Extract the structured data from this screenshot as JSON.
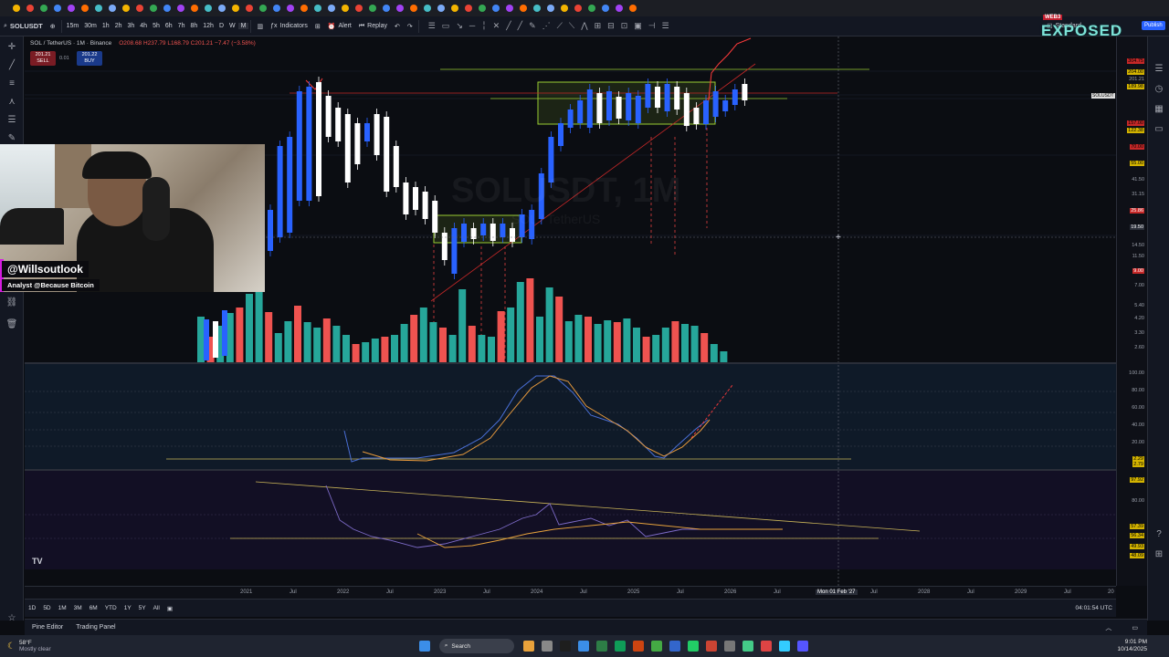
{
  "toolbar": {
    "symbol": "SOLUSDT",
    "intervals": [
      "15m",
      "30m",
      "1h",
      "2h",
      "3h",
      "4h",
      "5h",
      "6h",
      "7h",
      "8h",
      "12h",
      "D",
      "W",
      "M"
    ],
    "indicators_label": "Indicators",
    "alert_label": "Alert",
    "replay_label": "Replay",
    "layout_label": "Standard",
    "publish_label": "Publish"
  },
  "legend": {
    "pair": "SOL / TetherUS · 1M · Binance",
    "ohlc": "O208.68 H237.79 L168.79 C201.21 −7.47 (−3.58%)",
    "sell_price": "201.21",
    "sell_label": "SELL",
    "spread": "0.01",
    "buy_price": "201.22",
    "buy_label": "BUY"
  },
  "watermark": {
    "big": "SOLUSDT, 1M",
    "small": "SOL / TetherUS"
  },
  "webcam": {
    "handle": "@Willsoutlook",
    "role": "Analyst @Because Bitcoin"
  },
  "brand": {
    "logo": "EXPOSED",
    "badge": "WEB3"
  },
  "price_scale": {
    "labels": [
      "304.75",
      "204.00",
      "201.21",
      "189.98",
      "157.00",
      "122.38",
      "70.00",
      "55.00",
      "41.50",
      "31.15",
      "25.86",
      "19.50",
      "14.50",
      "11.50",
      "9.00",
      "7.00",
      "5.40",
      "4.20",
      "3.30",
      "2.60"
    ],
    "current_tag": "SOLUSDT",
    "current": "201.21"
  },
  "stoch_scale": {
    "labels": [
      "100.00",
      "80.00",
      "60.00",
      "40.00",
      "20.00"
    ],
    "value1": "2.29",
    "value2": "2.79"
  },
  "rsi_scale": {
    "labels": [
      "97.92",
      "80.00",
      "57.39",
      "56.34",
      "49.93",
      "48.09"
    ]
  },
  "time_axis": {
    "labels": [
      "2021",
      "Jul",
      "2022",
      "Jul",
      "2023",
      "Jul",
      "2024",
      "Jul",
      "2025",
      "Jul",
      "2026",
      "Jul",
      "Mon 01 Feb '27",
      "Jul",
      "2028",
      "Jul",
      "2029",
      "Jul",
      "20"
    ]
  },
  "range_bar": {
    "ranges": [
      "1D",
      "5D",
      "1M",
      "3M",
      "6M",
      "YTD",
      "1Y",
      "5Y",
      "All"
    ],
    "clock": "04:01:54 UTC"
  },
  "bottom_tabs": {
    "pine": "Pine Editor",
    "trading": "Trading Panel"
  },
  "taskbar": {
    "weather_temp": "58°F",
    "weather_desc": "Mostly clear",
    "search": "Search",
    "time": "9:01 PM",
    "date": "10/14/2025"
  },
  "colors": {
    "up": "#2962ff",
    "down": "#ffffff",
    "vol_up": "#26a69a",
    "vol_down": "#ef5350",
    "box": "#9acd32",
    "accent": "#ff2a2a"
  }
}
